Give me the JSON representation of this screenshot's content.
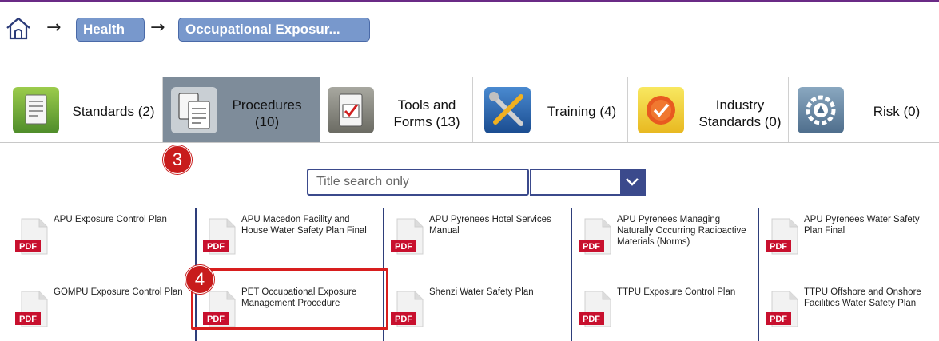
{
  "breadcrumb": {
    "home_icon": "home-icon",
    "arrow": "→",
    "items": [
      {
        "label": "Health"
      },
      {
        "label": "Occupational Exposur..."
      }
    ]
  },
  "tabs": [
    {
      "label": "Standards (2)",
      "icon": "standards-icon"
    },
    {
      "label": "Procedures\n(10)",
      "icon": "procedures-icon",
      "active": true
    },
    {
      "label": "Tools and\nForms (13)",
      "icon": "tools-forms-icon"
    },
    {
      "label": "Training (4)",
      "icon": "training-icon"
    },
    {
      "label": "Industry\nStandards (0)",
      "icon": "industry-standards-icon"
    },
    {
      "label": "Risk (0)",
      "icon": "risk-icon"
    }
  ],
  "annotations": {
    "badge_procedures": "3",
    "badge_document": "4"
  },
  "search": {
    "placeholder": "Title search only",
    "filter_value": ""
  },
  "documents": [
    {
      "title": "APU Exposure Control Plan",
      "type": "PDF"
    },
    {
      "title": "APU Macedon Facility and House Water Safety Plan Final",
      "type": "PDF"
    },
    {
      "title": "APU Pyrenees Hotel Services Manual",
      "type": "PDF"
    },
    {
      "title": "APU Pyrenees Managing Naturally Occurring Radioactive Materials (Norms)",
      "type": "PDF"
    },
    {
      "title": "APU Pyrenees Water Safety Plan Final",
      "type": "PDF"
    },
    {
      "title": "GOMPU Exposure Control Plan",
      "type": "PDF"
    },
    {
      "title": "PET Occupational Exposure Management Procedure",
      "type": "PDF"
    },
    {
      "title": "Shenzi Water Safety Plan",
      "type": "PDF"
    },
    {
      "title": "TTPU Exposure Control Plan",
      "type": "PDF"
    },
    {
      "title": "TTPU Offshore and Onshore Facilities Water Safety Plan",
      "type": "PDF"
    }
  ],
  "colors": {
    "accent": "#7898cc",
    "active_tab": "#7e8c9a",
    "badge": "#c81c1c",
    "border": "#3b4a8c",
    "pdf_red": "#c8102e"
  }
}
